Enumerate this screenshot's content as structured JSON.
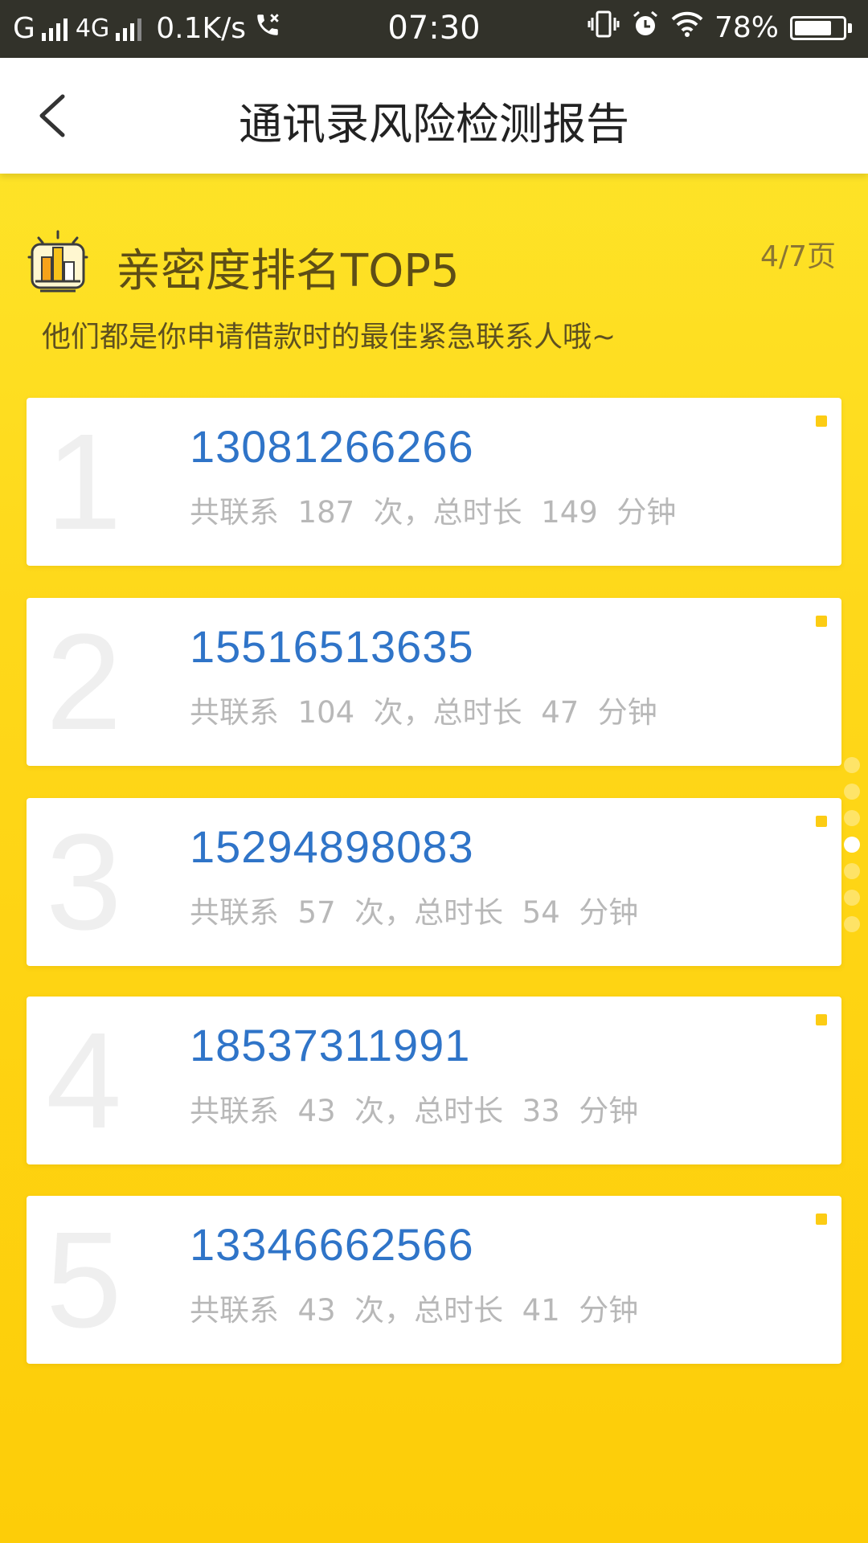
{
  "status_bar": {
    "carrier": "G",
    "network": "4G",
    "speed": "0.1K/s",
    "time": "07:30",
    "battery": "78%",
    "battery_level": 0.78
  },
  "nav": {
    "title": "通讯录风险检测报告",
    "back_icon": "chevron-left-icon"
  },
  "section": {
    "title": "亲密度排名TOP5",
    "page_indicator": "4/7页",
    "subtitle": "他们都是你申请借款时的最佳紧急联系人哦~",
    "icon": "ranking-bar-icon"
  },
  "contacts": [
    {
      "rank": "1",
      "phone": "13081266266",
      "stats": "共联系  187  次，总时长  149  分钟"
    },
    {
      "rank": "2",
      "phone": "15516513635",
      "stats": "共联系  104  次，总时长  47  分钟"
    },
    {
      "rank": "3",
      "phone": "15294898083",
      "stats": "共联系  57  次，总时长  54  分钟"
    },
    {
      "rank": "4",
      "phone": "18537311991",
      "stats": "共联系  43  次，总时长  33  分钟"
    },
    {
      "rank": "5",
      "phone": "13346662566",
      "stats": "共联系  43  次，总时长  41  分钟"
    }
  ],
  "pagination": {
    "total": 7,
    "current": 4
  },
  "colors": {
    "accent": "#fccc14",
    "phone_blue": "#2f74c8",
    "status_bar_bg": "#32322a"
  }
}
